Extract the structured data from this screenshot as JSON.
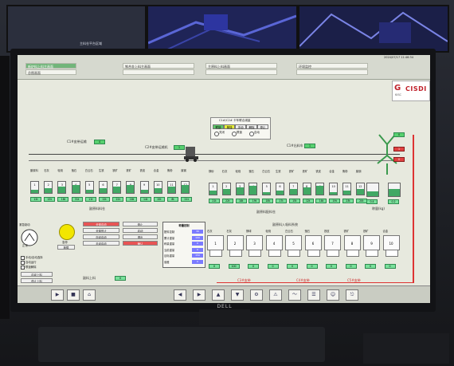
{
  "hmi": {
    "title": "",
    "tabs": [
      "新炉料上料主画面",
      "铁合金上料主画面",
      "主原料上料画面",
      "环境监控"
    ],
    "tab_sub": "总图画面",
    "time": "2024/07/17 11:46:34",
    "brand": "CISDI",
    "brand_sub": "中冶赛迪",
    "left_logo": "KISC",
    "control_panel": {
      "title": "C1#/C2# 卡车联合减量",
      "modes": [
        "联锁",
        "单独",
        "手动",
        "解除",
        "停止"
      ],
      "radios": [
        "关闭",
        "联锁",
        "自动"
      ]
    },
    "labels": {
      "belt_top": "C1#皮带运输",
      "belt_mid": "C2#皮带运输机",
      "car": "C1#出料车",
      "section1": "副原料料仓",
      "section2": "副原料配料仓",
      "section3": "副原料称量点",
      "section4": "副原料和备料系统",
      "lower_title": "副原料入吸料系统",
      "right_unit": "称量(kg)",
      "bottom_left1": "副料上料",
      "bottom_left2": "副料下料",
      "line_c3": "C3#皮带",
      "line_c4": "C4#皮带",
      "line_c5": "C5#皮带"
    },
    "upper_bins": [
      "1",
      "2",
      "3",
      "4",
      "5",
      "6",
      "7",
      "8",
      "9",
      "10",
      "11",
      "12"
    ],
    "upper_bin_names": [
      "副原料",
      "石灰",
      "轻烧",
      "萤石",
      "白云石",
      "生铁",
      "铁矿",
      "铁矿",
      "铁皮",
      "合金",
      "焦粉",
      "废钢"
    ],
    "upper_vals": [
      "12t",
      "15t",
      "18t",
      "31t",
      "11t",
      "12t",
      "22t",
      "18t",
      "14t",
      "15t",
      "8t",
      "21t"
    ],
    "mid_bins": [
      "1",
      "2",
      "3",
      "4",
      "5",
      "6",
      "7",
      "8",
      "9",
      "10",
      "11",
      "12"
    ],
    "mid_bin_names": [
      "镁砂",
      "石灰",
      "轻烧",
      "萤石",
      "白云石",
      "生铁",
      "铁矿",
      "铁矿",
      "铁皮",
      "合金",
      "焦粉",
      "废钢"
    ],
    "mid_vals": [
      "21t",
      "22t",
      "18t",
      "19t",
      "18t",
      "17t",
      "15t",
      "12t",
      "18t",
      "19t",
      "23t",
      "20t"
    ],
    "right_vals": [
      "0.4",
      "0.2"
    ],
    "lower_bins": [
      "1",
      "2",
      "3",
      "4",
      "5",
      "6",
      "7",
      "8",
      "9",
      "10"
    ],
    "lower_names": [
      "石灰",
      "石灰",
      "镁球",
      "轻烧",
      "白云石",
      "萤石",
      "铁皮",
      "铁矿",
      "铁矿",
      "合金"
    ],
    "lower_vals": [
      "0",
      "100",
      "0",
      "0",
      "0",
      "0",
      "0",
      "0",
      "0",
      "0"
    ],
    "buttons_left": [
      "全部启动",
      "全部停止",
      "自动启动",
      "手动启动"
    ],
    "buttons_right": [
      "停止",
      "启动",
      "退出",
      "确认"
    ],
    "ctrl_table": {
      "title": "称量控制",
      "rows": [
        {
          "label": "配料控制",
          "value": "30"
        },
        {
          "label": "累计重量",
          "value": "100"
        },
        {
          "label": "称量重量",
          "value": "0"
        },
        {
          "label": "当前重量",
          "value": "0"
        },
        {
          "label": "目标重量",
          "value": "150"
        },
        {
          "label": "误差",
          "value": "0"
        }
      ]
    },
    "left_status": {
      "lamp_label": "急停",
      "mode_label": "紧急制动",
      "checks": [
        "手动/自动选择",
        "自动运行",
        "联锁解除"
      ],
      "btn1": "启动上料",
      "btn2": "停止上料",
      "tag": "正常",
      "tag2": "故障"
    },
    "bottom_icons": [
      "play",
      "stop",
      "home",
      "left",
      "right",
      "up",
      "down",
      "setting",
      "alarm",
      "trend",
      "report",
      "user",
      "exit"
    ]
  }
}
